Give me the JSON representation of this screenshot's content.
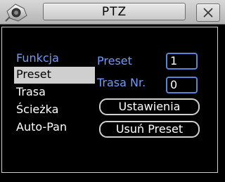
{
  "window": {
    "title": "PTZ"
  },
  "icons": {
    "logo": "camera-logo-icon",
    "close": "close-icon"
  },
  "menu": {
    "header": "Funkcja",
    "items": [
      {
        "label": "Preset",
        "selected": true
      },
      {
        "label": "Trasa",
        "selected": false
      },
      {
        "label": "Ścieżka",
        "selected": false
      },
      {
        "label": "Auto-Pan",
        "selected": false
      }
    ]
  },
  "form": {
    "preset_label": "Preset",
    "preset_value": "1",
    "trasa_label": "Trasa Nr.",
    "trasa_value": "0"
  },
  "buttons": {
    "settings": "Ustawienia",
    "delete_preset": "Usuń Preset"
  },
  "colors": {
    "accent_label": "#6f9bff",
    "field_border": "#5a85d8",
    "selection": "#cfcfcf"
  }
}
